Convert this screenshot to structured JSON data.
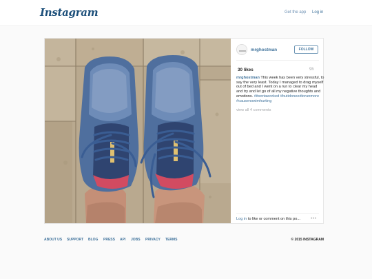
{
  "header": {
    "logo": "Instagram",
    "get_app": "Get the app",
    "login": "Log in"
  },
  "post": {
    "username": "mrghostman",
    "follow_label": "FOLLOW",
    "likes": "30 likes",
    "age": "9h",
    "caption": {
      "username": "mrghostman",
      "text": "This week has been very stressful, to say the very least. Today I managed to drag myself out of bed and I went on a run to clear my head and try and let go of all my negative thoughts and emotions.",
      "hashtags": [
        "#itsortaworked",
        "#butidoneedtorunmore",
        "#causenowimhurting"
      ]
    },
    "view_comments": "view all 4 comments",
    "footer": {
      "login": "Log in",
      "rest": "to like or comment on this po..."
    },
    "more_icon": "more-dots-icon"
  },
  "footer": {
    "links": [
      "ABOUT US",
      "SUPPORT",
      "BLOG",
      "PRESS",
      "API",
      "JOBS",
      "PRIVACY",
      "TERMS"
    ],
    "copyright": "© 2015 INSTAGRAM"
  },
  "colors": {
    "link_blue": "#3f729b",
    "background": "#fafafa"
  }
}
